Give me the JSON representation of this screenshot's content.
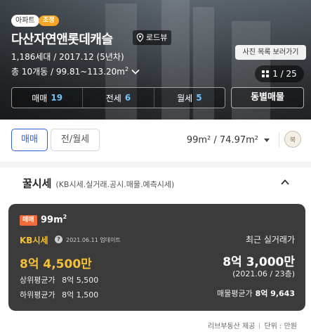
{
  "hero": {
    "type_chip": "아파트",
    "condition_chip": "조정",
    "title": "다산자연앤롯데캐슬",
    "roadview_label": "로드뷰",
    "households_built": "1,186세대 / 2017.12 (5년차)",
    "buildings_area_prefix": "총 10개동 / 99.81~113.20m",
    "buildings_area_sup": "2",
    "photo_tip": "사진 목록 보러가기",
    "photo_counter": "1 / 25"
  },
  "trades": {
    "sale_label": "매매",
    "sale_count": "19",
    "jeonse_label": "전세",
    "jeonse_count": "6",
    "wolse_label": "월세",
    "wolse_count": "5",
    "dong_button": "동별매물"
  },
  "filter": {
    "sale_tab": "매매",
    "rent_tab": "전/월세",
    "area_text": "99m² / 74.97m²",
    "compass_label": "북"
  },
  "section": {
    "title": "꿀시세",
    "subtitle": "(KB시세.실거래.공시.매물.예측시세)"
  },
  "card": {
    "badge": "매매",
    "area": "99m",
    "area_sup": "2",
    "kb_label": "KB시세",
    "help_symbol": "?",
    "kb_updated": "2021.06.11 업데이트",
    "kb_price": "8억 4,500만",
    "upper_avg_label": "상위평균가",
    "upper_avg_value": "8억 5,500",
    "lower_avg_label": "하위평균가",
    "lower_avg_value": "8억 1,500",
    "recent_label": "최근 실거래가",
    "recent_price": "8억 3,000만",
    "recent_meta": "(2021.06 / 23층)",
    "ask_avg_label": "매물평균가",
    "ask_avg_value": "8억 9,643"
  },
  "footer": {
    "provider": "리브부동산 제공",
    "unit": "단위 : 만원"
  },
  "colors": {
    "accent_blue": "#2b62d9",
    "kb_yellow": "#f5c036",
    "sale_badge": "#f16b3a",
    "condition_chip": "#f5a623",
    "count_blue": "#6fc3ff"
  }
}
